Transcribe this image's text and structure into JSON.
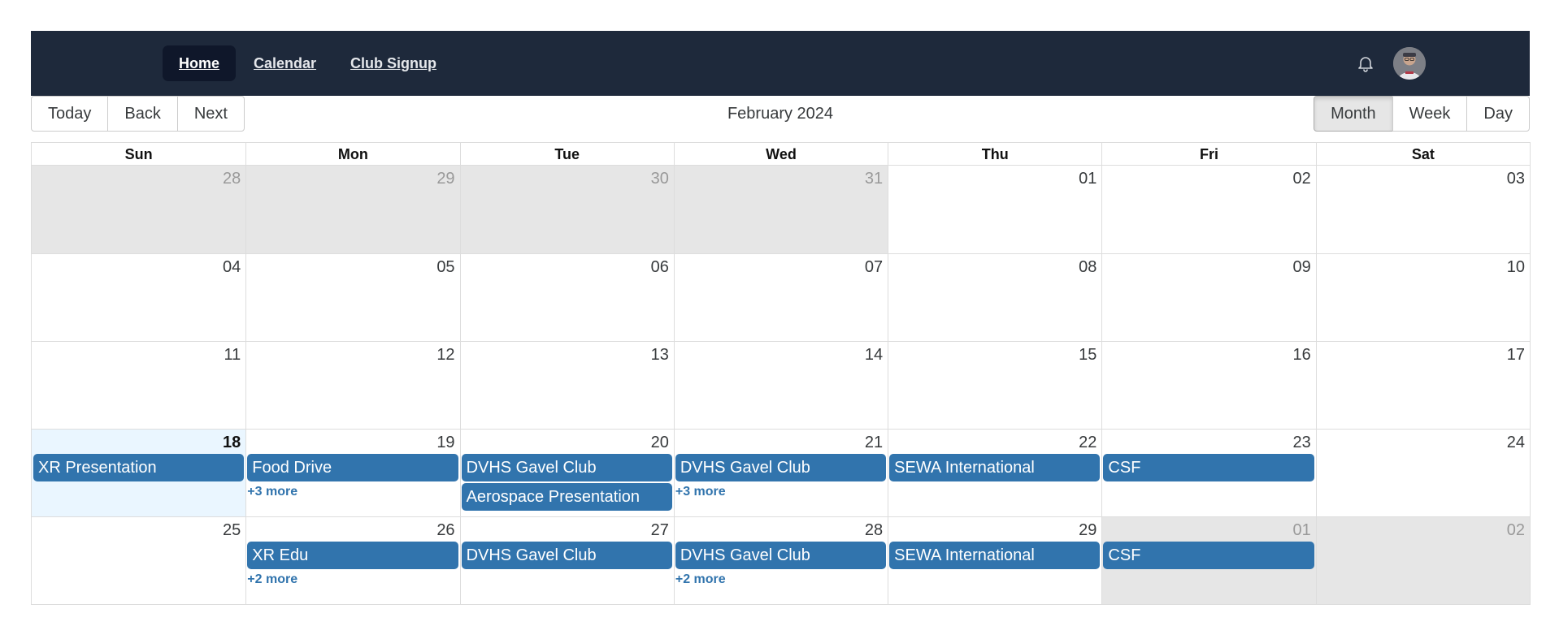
{
  "nav": {
    "links": [
      {
        "label": "Home",
        "active": true
      },
      {
        "label": "Calendar",
        "active": false
      },
      {
        "label": "Club Signup",
        "active": false
      }
    ],
    "bg_color": "#1e293b"
  },
  "toolbar": {
    "today": "Today",
    "back": "Back",
    "next": "Next",
    "label": "February 2024",
    "views": [
      {
        "label": "Month",
        "active": true
      },
      {
        "label": "Week",
        "active": false
      },
      {
        "label": "Day",
        "active": false
      }
    ]
  },
  "calendar": {
    "event_color": "#3174ad",
    "headers": [
      "Sun",
      "Mon",
      "Tue",
      "Wed",
      "Thu",
      "Fri",
      "Sat"
    ],
    "weeks": [
      [
        {
          "date": "28",
          "off": true,
          "events": [],
          "more": ""
        },
        {
          "date": "29",
          "off": true,
          "events": [],
          "more": ""
        },
        {
          "date": "30",
          "off": true,
          "events": [],
          "more": ""
        },
        {
          "date": "31",
          "off": true,
          "events": [],
          "more": ""
        },
        {
          "date": "01",
          "off": false,
          "events": [],
          "more": ""
        },
        {
          "date": "02",
          "off": false,
          "events": [],
          "more": ""
        },
        {
          "date": "03",
          "off": false,
          "events": [],
          "more": ""
        }
      ],
      [
        {
          "date": "04",
          "off": false,
          "events": [],
          "more": ""
        },
        {
          "date": "05",
          "off": false,
          "events": [],
          "more": ""
        },
        {
          "date": "06",
          "off": false,
          "events": [],
          "more": ""
        },
        {
          "date": "07",
          "off": false,
          "events": [],
          "more": ""
        },
        {
          "date": "08",
          "off": false,
          "events": [],
          "more": ""
        },
        {
          "date": "09",
          "off": false,
          "events": [],
          "more": ""
        },
        {
          "date": "10",
          "off": false,
          "events": [],
          "more": ""
        }
      ],
      [
        {
          "date": "11",
          "off": false,
          "events": [],
          "more": ""
        },
        {
          "date": "12",
          "off": false,
          "events": [],
          "more": ""
        },
        {
          "date": "13",
          "off": false,
          "events": [],
          "more": ""
        },
        {
          "date": "14",
          "off": false,
          "events": [],
          "more": ""
        },
        {
          "date": "15",
          "off": false,
          "events": [],
          "more": ""
        },
        {
          "date": "16",
          "off": false,
          "events": [],
          "more": ""
        },
        {
          "date": "17",
          "off": false,
          "events": [],
          "more": ""
        }
      ],
      [
        {
          "date": "18",
          "off": false,
          "today": true,
          "events": [
            "XR Presentation"
          ],
          "more": ""
        },
        {
          "date": "19",
          "off": false,
          "events": [
            "Food Drive"
          ],
          "more": "+3 more"
        },
        {
          "date": "20",
          "off": false,
          "events": [
            "DVHS Gavel Club",
            "Aerospace Presentation"
          ],
          "more": ""
        },
        {
          "date": "21",
          "off": false,
          "events": [
            "DVHS Gavel Club"
          ],
          "more": "+3 more"
        },
        {
          "date": "22",
          "off": false,
          "events": [
            "SEWA International"
          ],
          "more": ""
        },
        {
          "date": "23",
          "off": false,
          "events": [
            "CSF"
          ],
          "more": ""
        },
        {
          "date": "24",
          "off": false,
          "events": [],
          "more": ""
        }
      ],
      [
        {
          "date": "25",
          "off": false,
          "events": [],
          "more": ""
        },
        {
          "date": "26",
          "off": false,
          "events": [
            "XR Edu"
          ],
          "more": "+2 more"
        },
        {
          "date": "27",
          "off": false,
          "events": [
            "DVHS Gavel Club"
          ],
          "more": ""
        },
        {
          "date": "28",
          "off": false,
          "events": [
            "DVHS Gavel Club"
          ],
          "more": "+2 more"
        },
        {
          "date": "29",
          "off": false,
          "events": [
            "SEWA International"
          ],
          "more": ""
        },
        {
          "date": "01",
          "off": true,
          "events": [
            "CSF"
          ],
          "more": ""
        },
        {
          "date": "02",
          "off": true,
          "events": [],
          "more": ""
        }
      ]
    ]
  }
}
